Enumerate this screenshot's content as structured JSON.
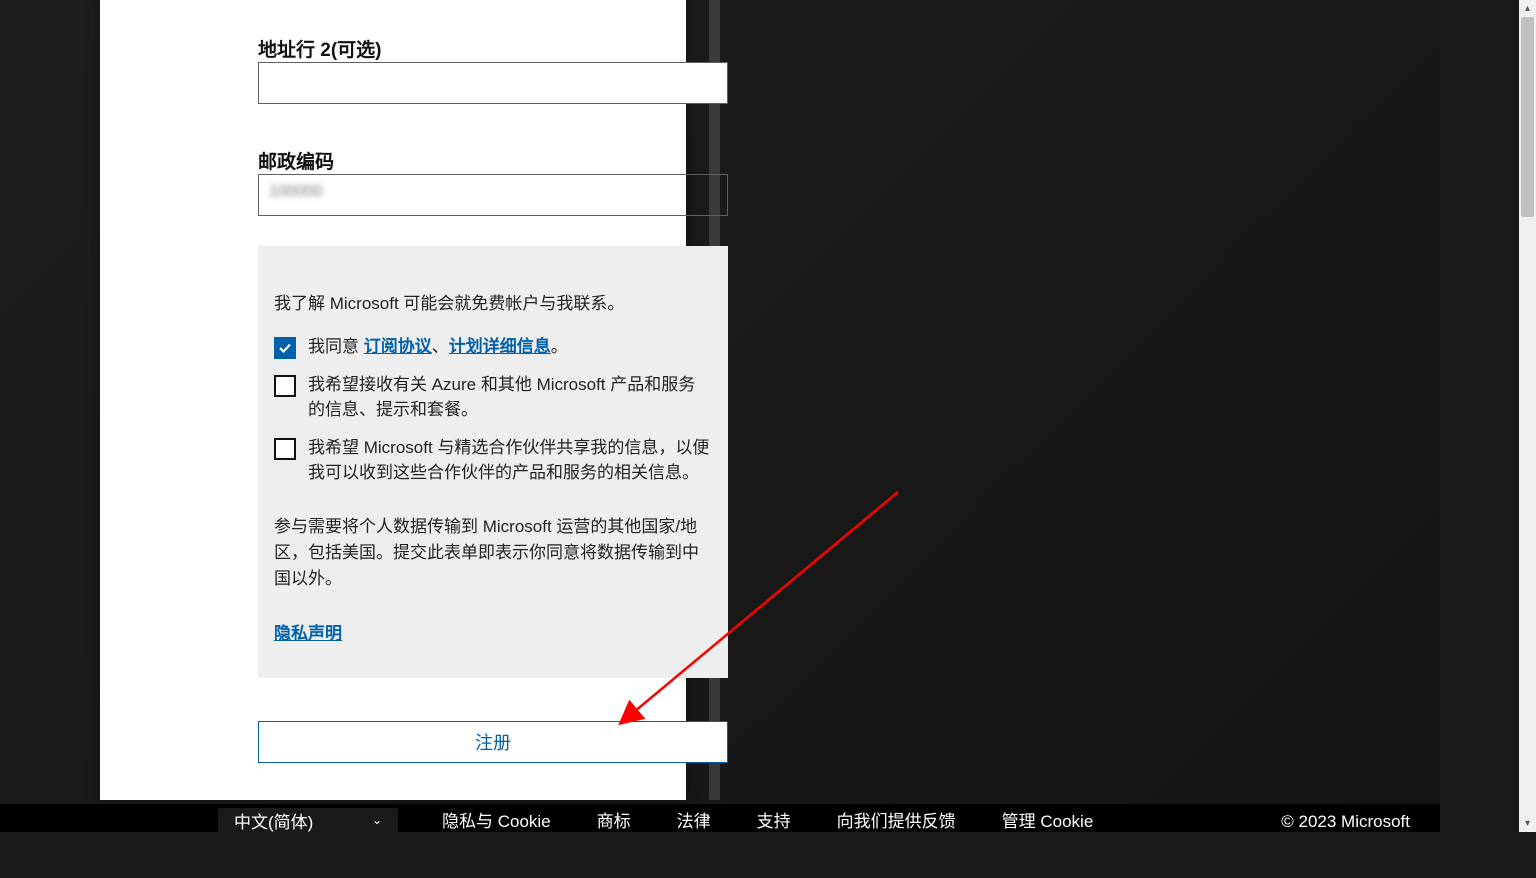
{
  "form": {
    "address2_label": "地址行 2(可选)",
    "address2_value": "",
    "postal_label": "邮政编码",
    "postal_value": "100000"
  },
  "agreement": {
    "intro": "我了解 Microsoft 可能会就免费帐户与我联系。",
    "agree_prefix": "我同意 ",
    "subscription_agreement_link": "订阅协议",
    "separator": "、",
    "plan_details_link": "计划详细信息",
    "suffix": "。",
    "marketing_optin": "我希望接收有关 Azure 和其他 Microsoft 产品和服务的信息、提示和套餐。",
    "partner_optin": "我希望 Microsoft 与精选合作伙伴共享我的信息，以便我可以收到这些合作伙伴的产品和服务的相关信息。",
    "data_transfer": "参与需要将个人数据传输到 Microsoft 运营的其他国家/地区，包括美国。提交此表单即表示你同意将数据传输到中国以外。",
    "privacy_link": "隐私声明"
  },
  "actions": {
    "register": "注册"
  },
  "footer": {
    "language": "中文(简体)",
    "privacy_cookie": "隐私与 Cookie",
    "trademark": "商标",
    "legal": "法律",
    "support": "支持",
    "feedback": "向我们提供反馈",
    "manage_cookie": "管理 Cookie",
    "copyright": "© 2023 Microsoft"
  }
}
